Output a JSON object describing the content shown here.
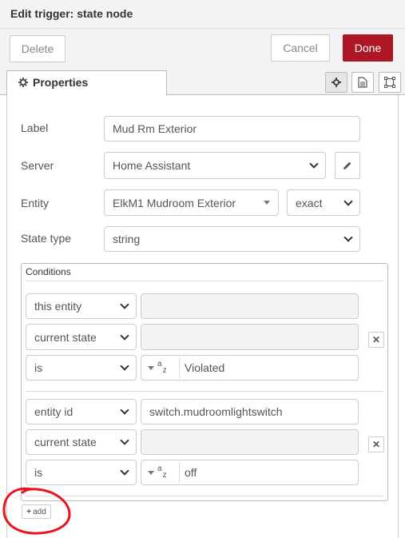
{
  "titlebar": {
    "title": "Edit trigger: state node"
  },
  "actions": {
    "delete": "Delete",
    "cancel": "Cancel",
    "done": "Done"
  },
  "tabs": {
    "properties": "Properties"
  },
  "icons": {
    "gear": "gear-icon",
    "description": "document-icon",
    "appearance": "frame-icon",
    "edit": "pencil-icon",
    "close": "close-icon",
    "plus": "plus-icon"
  },
  "form": {
    "label": {
      "label": "Label",
      "value": "Mud Rm Exterior"
    },
    "server": {
      "label": "Server",
      "value": "Home Assistant"
    },
    "entity": {
      "label": "Entity",
      "value": "ElkM1 Mudroom Exterior",
      "match": "exact"
    },
    "state_type": {
      "label": "State type",
      "value": "string"
    }
  },
  "conditions": {
    "legend": "Conditions",
    "groups": [
      {
        "target": "this entity",
        "target_value": "",
        "property": "current state",
        "property_value": "",
        "comparator": "is",
        "type_icon": "az",
        "value": "Violated"
      },
      {
        "target": "entity id",
        "target_value": "switch.mudroomlightswitch",
        "property": "current state",
        "property_value": "",
        "comparator": "is",
        "type_icon": "az",
        "value": "off"
      }
    ],
    "add_label": "add"
  },
  "colors": {
    "done": "#ad1625",
    "annotation": "#e8141e"
  }
}
